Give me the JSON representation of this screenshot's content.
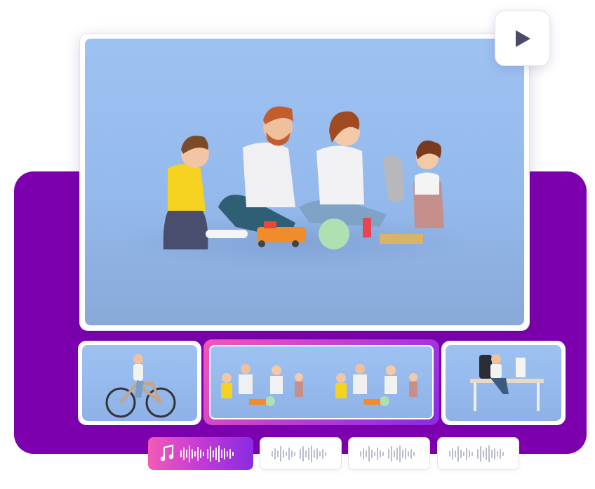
{
  "player": {
    "play_icon": "play-icon",
    "main_scene": "family-playing-with-toys-scene"
  },
  "timeline": {
    "clips": [
      {
        "scene": "woman-riding-bicycle",
        "selected": false
      },
      {
        "scene": "family-playing-with-toys-repeated",
        "selected": true
      },
      {
        "scene": "man-working-at-desk",
        "selected": false
      }
    ],
    "audio_tracks": [
      {
        "icon": "music-note-icon",
        "active": true
      },
      {
        "icon": "waveform-icon",
        "active": false
      },
      {
        "icon": "waveform-icon",
        "active": false
      },
      {
        "icon": "waveform-icon",
        "active": false
      }
    ]
  },
  "colors": {
    "panel": "#7c00ad",
    "accent_pink": "#f25bb6",
    "accent_violet": "#8a2be2",
    "scene_sky": "#9dc2f2"
  }
}
